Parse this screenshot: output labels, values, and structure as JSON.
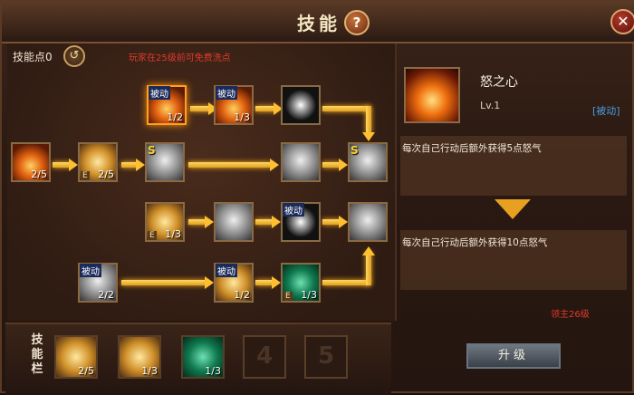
{
  "window": {
    "title": "技能",
    "help_label": "?",
    "close_label": "✕"
  },
  "header": {
    "points_label": "技能点0",
    "reset_icon": "↺",
    "tip": "玩家在25级前可免费洗点"
  },
  "skills": [
    {
      "id": "r1a",
      "tag": "被动",
      "level": "1/2",
      "icon": "fire-pillar-icon"
    },
    {
      "id": "r1b",
      "tag": "被动",
      "level": "1/3",
      "icon": "blade-aura-icon"
    },
    {
      "id": "r1c",
      "icon": "dark-ring-icon"
    },
    {
      "id": "r2a",
      "level": "2/5",
      "icon": "slash-icon"
    },
    {
      "id": "r2b",
      "mark_e": "E",
      "level": "2/5",
      "icon": "sword-strike-icon"
    },
    {
      "id": "r2c",
      "mark_s": "S",
      "icon": "sword-rain-icon"
    },
    {
      "id": "r2d",
      "icon": "whirlwind-icon"
    },
    {
      "id": "r2e",
      "mark_s": "S",
      "icon": "light-burst-icon"
    },
    {
      "id": "r3a",
      "mark_e": "E",
      "level": "1/3",
      "icon": "golden-shield-icon"
    },
    {
      "id": "r3b",
      "icon": "claw-slash-icon"
    },
    {
      "id": "r3c",
      "tag": "被动",
      "icon": "guardian-icon"
    },
    {
      "id": "r3d",
      "icon": "angel-icon"
    },
    {
      "id": "r4a",
      "tag": "被动",
      "level": "2/2",
      "icon": "armor-icon"
    },
    {
      "id": "r4b",
      "tag": "被动",
      "level": "1/2",
      "icon": "sword-plunge-icon"
    },
    {
      "id": "r4c",
      "mark_e": "E",
      "level": "1/3",
      "icon": "warrior-emblem-icon"
    }
  ],
  "detail": {
    "name": "怒之心",
    "level": "Lv.1",
    "type": "[被动]",
    "desc_current": "每次自己行动后额外获得5点怒气",
    "desc_next": "每次自己行动后额外获得10点怒气",
    "requirement": "领主26级",
    "upgrade_label": "升级"
  },
  "skillbar": {
    "label": "技能栏",
    "slots": [
      {
        "level": "2/5",
        "icon": "sword-strike-icon"
      },
      {
        "level": "1/3",
        "icon": "golden-shield-icon"
      },
      {
        "level": "1/3",
        "icon": "warrior-emblem-icon"
      },
      {
        "num": "4"
      },
      {
        "num": "5"
      }
    ]
  }
}
